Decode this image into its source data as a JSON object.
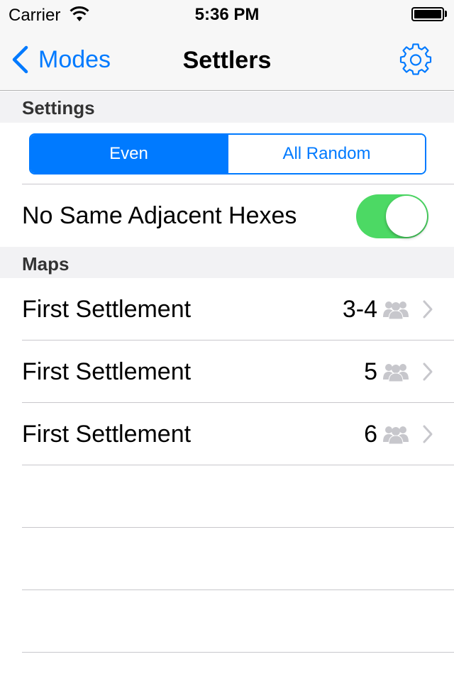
{
  "status_bar": {
    "carrier": "Carrier",
    "time": "5:36 PM"
  },
  "nav": {
    "back_label": "Modes",
    "title": "Settlers"
  },
  "sections": {
    "settings": "Settings",
    "maps": "Maps"
  },
  "segmented": {
    "options": [
      "Even",
      "All Random"
    ],
    "selected": "Even"
  },
  "toggle": {
    "label": "No Same Adjacent Hexes",
    "on": true
  },
  "maps": [
    {
      "name": "First Settlement",
      "players": "3-4"
    },
    {
      "name": "First Settlement",
      "players": "5"
    },
    {
      "name": "First Settlement",
      "players": "6"
    }
  ],
  "colors": {
    "accent": "#007aff",
    "toggle_on": "#4cd964",
    "secondary_icon": "#c7c7cc",
    "section_bg": "#f2f2f4"
  }
}
